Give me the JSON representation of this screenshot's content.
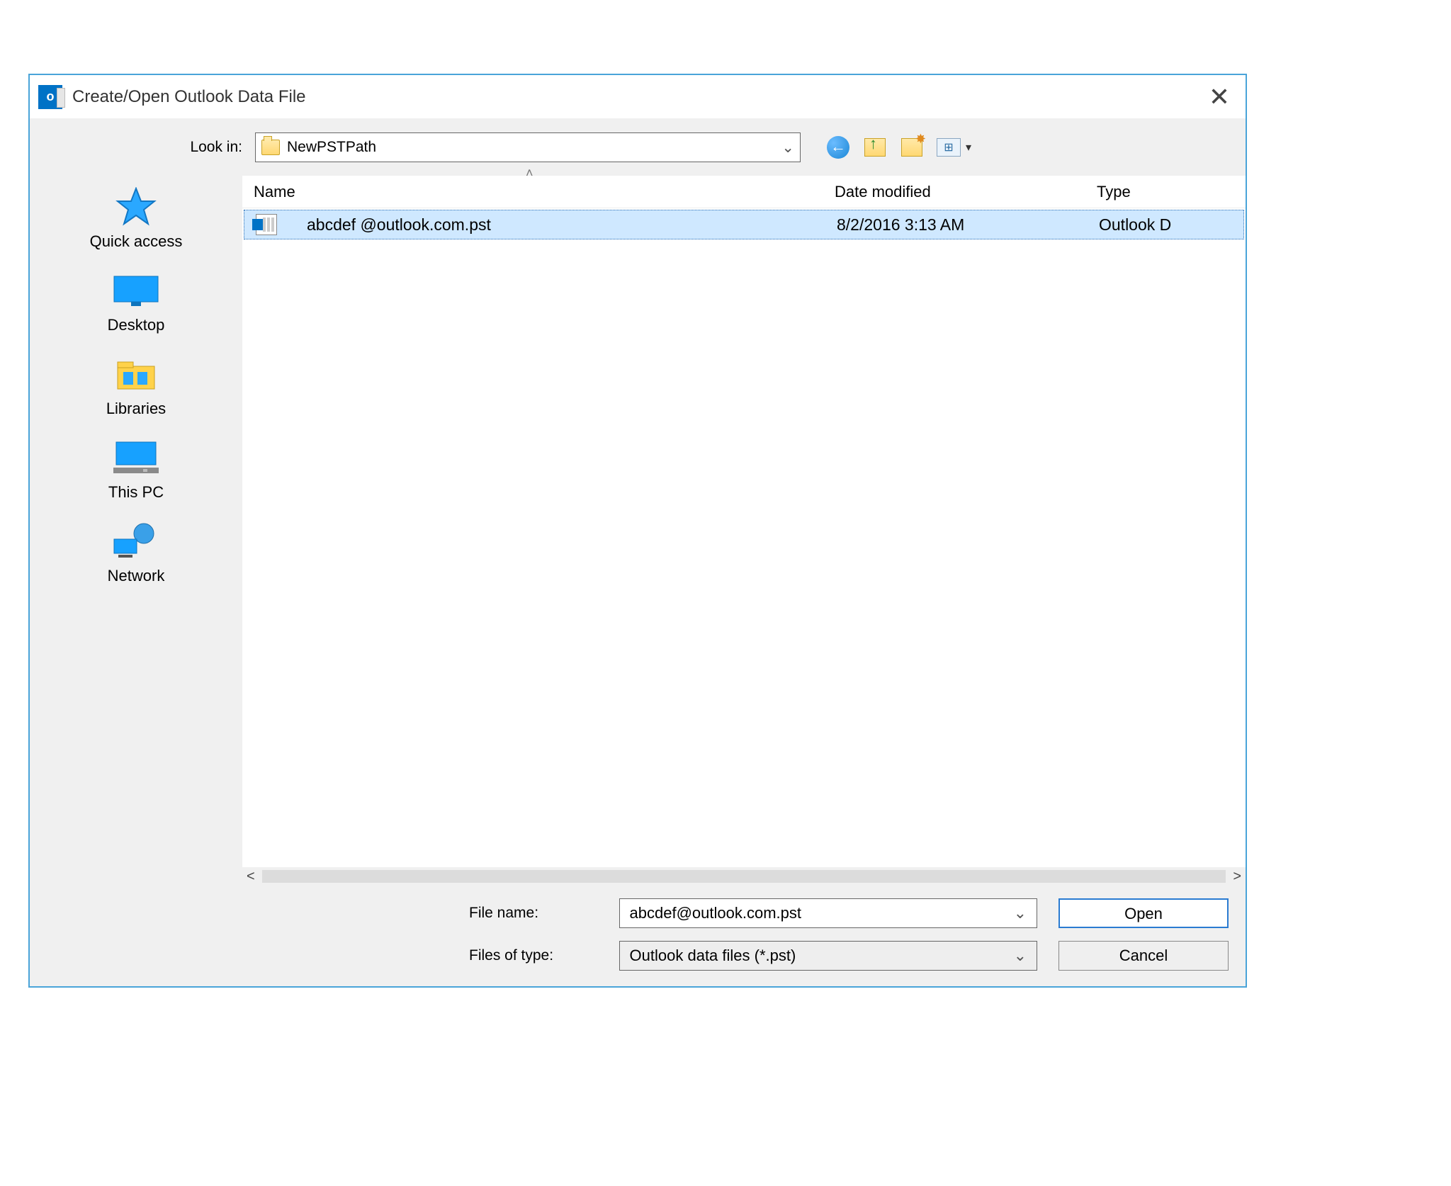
{
  "titlebar": {
    "title": "Create/Open Outlook Data File"
  },
  "lookin": {
    "label": "Look in:",
    "value": "NewPSTPath"
  },
  "nav": {
    "back": "back",
    "up": "up-one-level",
    "newfolder": "create-new-folder",
    "views": "views"
  },
  "places": {
    "quick_access": "Quick access",
    "desktop": "Desktop",
    "libraries": "Libraries",
    "this_pc": "This PC",
    "network": "Network"
  },
  "list": {
    "columns": {
      "name": "Name",
      "date_modified": "Date modified",
      "type": "Type"
    },
    "rows": [
      {
        "name": "abcdef @outlook.com.pst",
        "date_modified": "8/2/2016 3:13 AM",
        "type": "Outlook D"
      }
    ]
  },
  "bottom": {
    "file_name_label": "File name:",
    "file_name_value": "abcdef@outlook.com.pst",
    "files_of_type_label": "Files of type:",
    "files_of_type_value": "Outlook data files (*.pst)",
    "open": "Open",
    "cancel": "Cancel"
  }
}
